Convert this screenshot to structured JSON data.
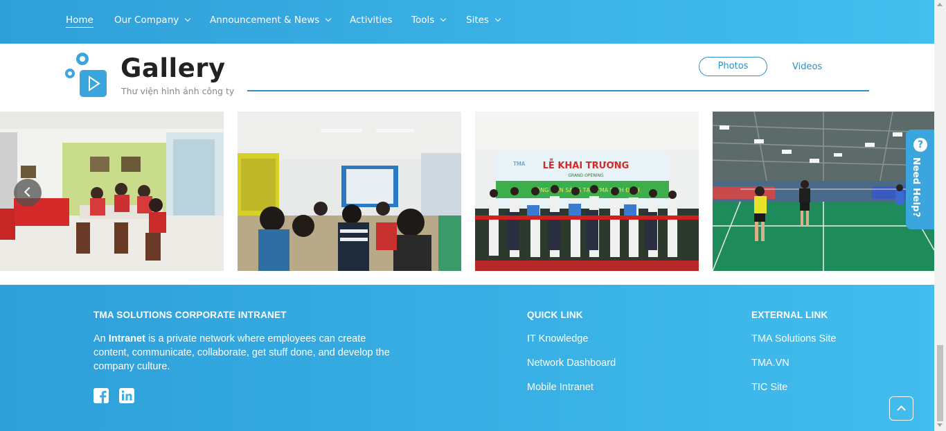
{
  "nav": {
    "items": [
      {
        "label": "Home",
        "active": true,
        "dropdown": false
      },
      {
        "label": "Our Company",
        "dropdown": true
      },
      {
        "label": "Announcement & News",
        "dropdown": true
      },
      {
        "label": "Activities",
        "dropdown": false
      },
      {
        "label": "Tools",
        "dropdown": true
      },
      {
        "label": "Sites",
        "dropdown": true
      }
    ]
  },
  "gallery": {
    "title": "Gallery",
    "subtitle": "Thư viện hình ảnh công ty",
    "tabs": [
      "Photos",
      "Videos"
    ],
    "photo3_banner_title": "LỄ KHAI TRƯƠNG",
    "photo3_banner_sub": "GRAND OPENING",
    "photo3_logo": "TMA",
    "photo3_strip": "CÔNG VIÊN SÁNG TẠO TMA BÌNH ĐỊNH"
  },
  "help": {
    "label": "Need Help?",
    "icon": "?"
  },
  "footer": {
    "about_title": "TMA SOLUTIONS CORPORATE INTRANET",
    "about_pre": "An ",
    "about_bold": "Intranet",
    "about_post": " is a private network where employees can create content, communicate, collaborate, get stuff done, and develop the company culture.",
    "quick_title": "QUICK LINK",
    "quick_links": [
      "IT Knowledge",
      "Network Dashboard",
      "Mobile Intranet"
    ],
    "external_title": "EXTERNAL LINK",
    "external_links": [
      "TMA Solutions Site",
      "TMA.VN",
      "TIC Site"
    ]
  },
  "colors": {
    "primary": "#2c8fc6",
    "footer": "#38b0e5",
    "nav": "#3bb3e6"
  },
  "icons": [
    "chevron-down-icon",
    "gallery-logo-icon",
    "chevron-left-icon",
    "help-icon",
    "facebook-icon",
    "linkedin-icon",
    "chevron-up-icon"
  ]
}
